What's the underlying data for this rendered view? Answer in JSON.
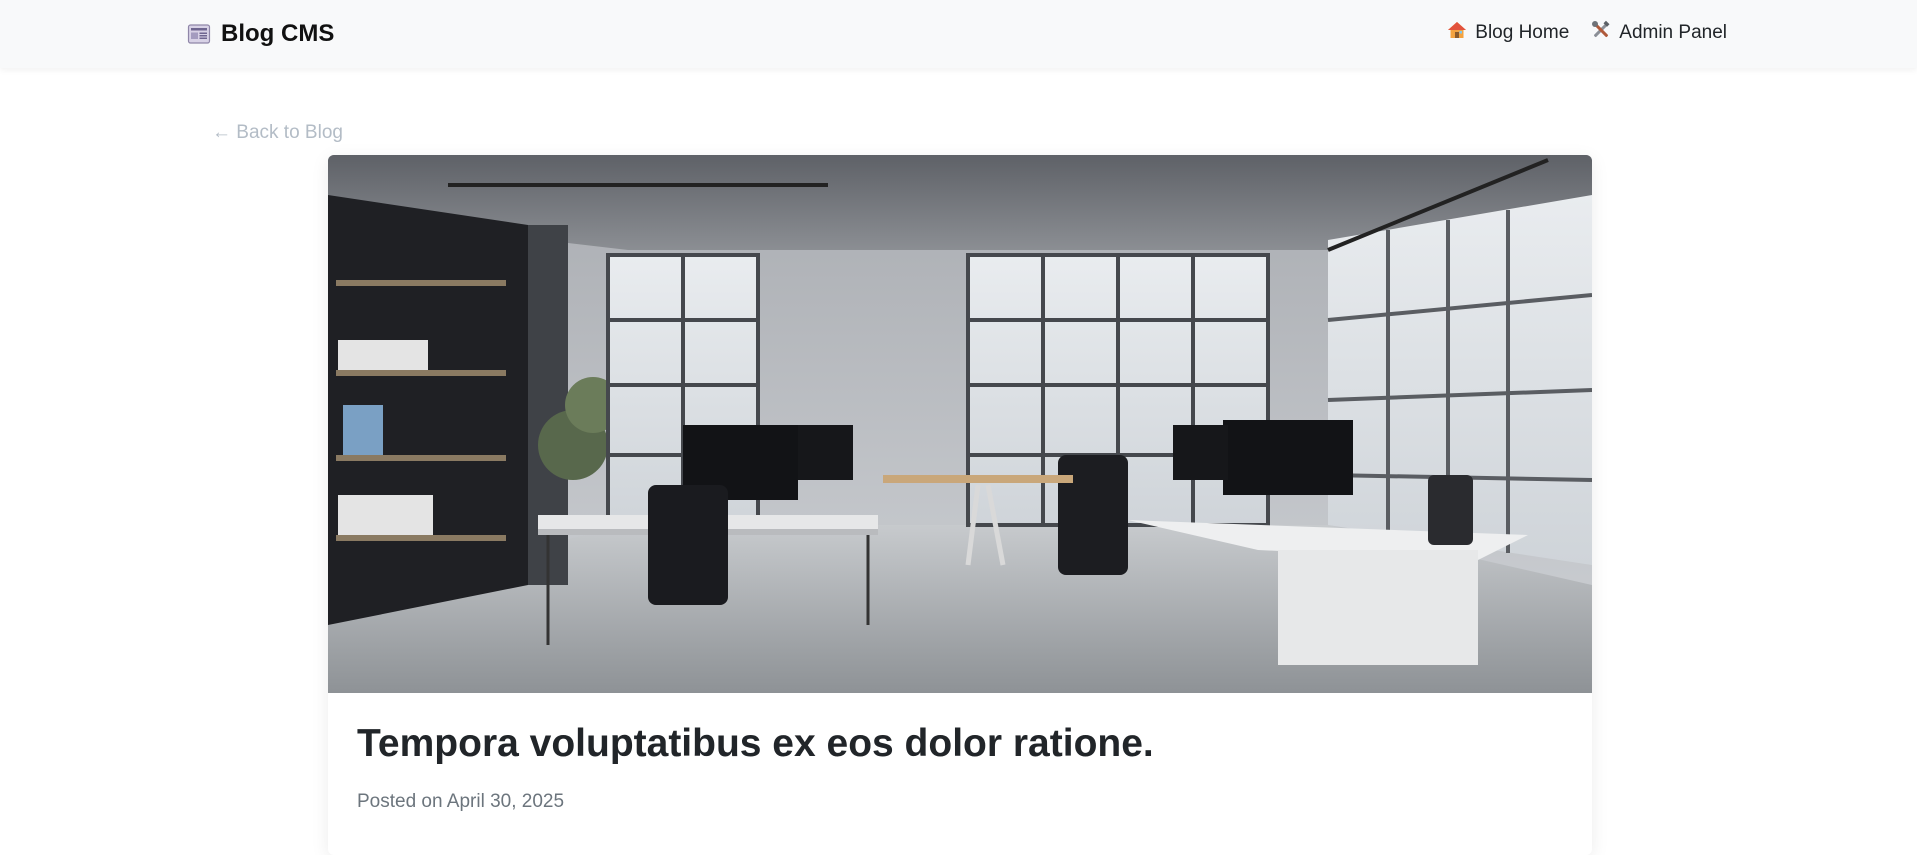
{
  "app": {
    "title": "Blog CMS",
    "brand_icon": "newspaper-icon"
  },
  "nav": {
    "items": [
      {
        "label": "Blog Home",
        "icon": "house-icon"
      },
      {
        "label": "Admin Panel",
        "icon": "tools-icon"
      }
    ]
  },
  "back_link": {
    "label": "← Back to Blog"
  },
  "post": {
    "title": "Tempora voluptatibus ex eos dolor ratione.",
    "date_label": "Posted on April 30, 2025",
    "image": "office-interior-photo"
  },
  "colors": {
    "navbar_bg": "#f8f9fa",
    "back_link": "#b3bcc6",
    "muted_text": "#6c757d"
  }
}
